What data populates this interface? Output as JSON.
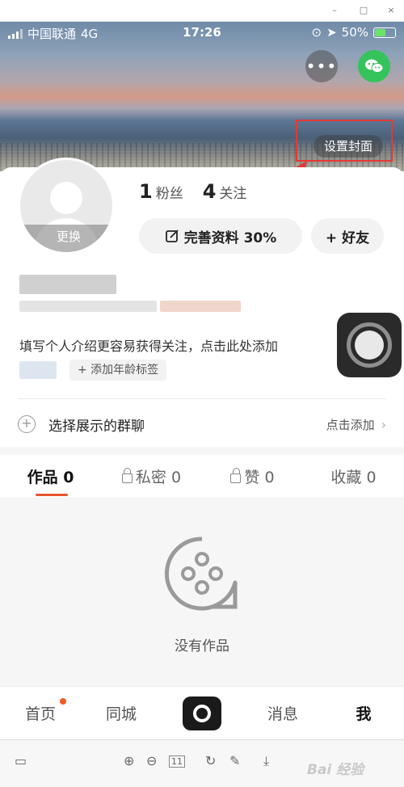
{
  "window": {
    "minimize": "–",
    "maximize": "□",
    "close": "×"
  },
  "status_bar": {
    "carrier": "中国联通",
    "network": "4G",
    "time": "17:26",
    "battery": "50%"
  },
  "cover": {
    "set_cover_label": "设置封面",
    "more_icon": "more-dots-icon",
    "share_icon": "wechat-icon"
  },
  "profile": {
    "avatar_change_label": "更换",
    "fans_count": "1",
    "fans_label": "粉丝",
    "following_count": "4",
    "following_label": "关注",
    "edit_profile_label": "完善资料 30%",
    "add_friend_label": "+ 好友",
    "intro_text": "填写个人介绍更容易获得关注，点击此处添加",
    "age_tag_label": "+ 添加年龄标签"
  },
  "group": {
    "title": "选择展示的群聊",
    "action": "点击添加"
  },
  "tabs": [
    {
      "label": "作品 0"
    },
    {
      "label": "私密 0"
    },
    {
      "label": "赞 0"
    },
    {
      "label": "收藏 0"
    }
  ],
  "empty_state": {
    "text": "没有作品"
  },
  "bottom_nav": [
    {
      "label": "首页"
    },
    {
      "label": "同城"
    },
    {
      "label": ""
    },
    {
      "label": "消息"
    },
    {
      "label": "我"
    }
  ],
  "viewer_toolbar": {
    "page_indicator": "11",
    "watermark": "Bai 经验"
  },
  "colors": {
    "accent": "#e8542f",
    "annotation_red": "#e53935",
    "wechat_green": "#35c35b"
  }
}
